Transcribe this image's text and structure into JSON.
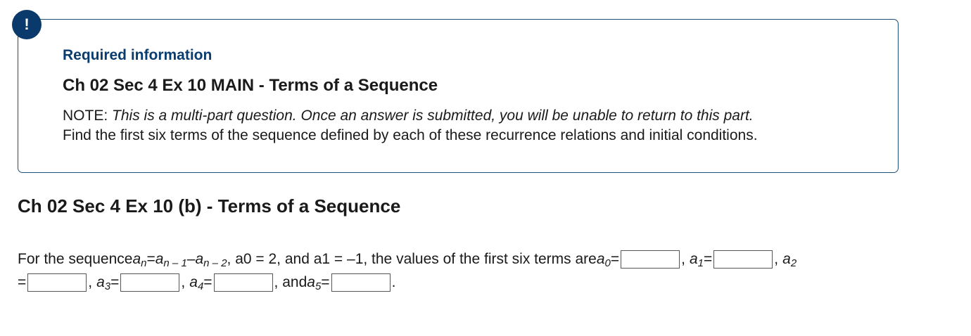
{
  "alert": {
    "symbol": "!"
  },
  "info": {
    "required_label": "Required information",
    "title": "Ch 02 Sec 4 Ex 10 MAIN - Terms of a Sequence",
    "note_prefix": "NOTE: ",
    "note_italic": "This is a multi-part question. Once an answer is submitted, you will be unable to return to this part.",
    "instruction": "Find the first six terms of the sequence defined by each of these recurrence relations and initial conditions."
  },
  "part": {
    "title": "Ch 02 Sec 4 Ex 10 (b) - Terms of a Sequence"
  },
  "question": {
    "lead": "For the sequence ",
    "a": "a",
    "n": "n",
    "eq": " = ",
    "n_minus_1": "n – 1",
    "minus": " – ",
    "n_minus_2": "n – 2",
    "a0_init": ", a0 = 2, and a1 = –1, the values of the first six terms are ",
    "a0_label": "0",
    "a1_label": "1",
    "a2_label": "2",
    "a3_label": "3",
    "a4_label": "4",
    "a5_label": "5",
    "eq_sign": " = ",
    "comma": ",",
    "and_text": ", and ",
    "end": "."
  },
  "answers": {
    "a0": "",
    "a1": "",
    "a2": "",
    "a3": "",
    "a4": "",
    "a5": ""
  }
}
